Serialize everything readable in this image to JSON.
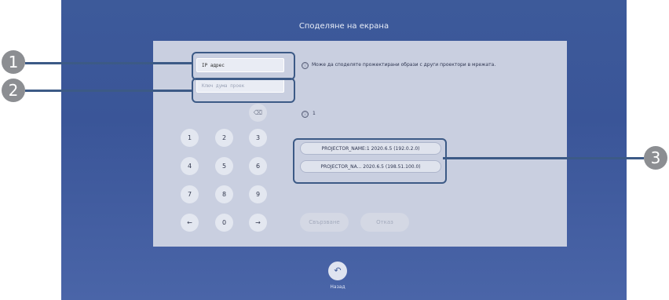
{
  "screen": {
    "title": "Споделяне на екрана"
  },
  "fields": {
    "ip": {
      "value": "IP адрес"
    },
    "keyword": {
      "placeholder": "Ключ дума проек"
    }
  },
  "info": {
    "icon": "ⓘ",
    "text": "Може да споделяте прожектирани образи с други проектори в мрежата."
  },
  "results": {
    "count": "1",
    "items": [
      "PROJECTOR_NAME:1  2020.6.5 (192.0.2.0)",
      "PROJECTOR_NA...  2020.6.5 (198.51.100.0)"
    ]
  },
  "keypad": {
    "keys": [
      "1",
      "2",
      "3",
      "4",
      "5",
      "6",
      "7",
      "8",
      "9",
      "←",
      "0",
      "→"
    ],
    "backspace": "⌫"
  },
  "actions": {
    "connect": "Свързване",
    "cancel": "Отказ"
  },
  "nav": {
    "back_label": "Назад",
    "back_icon": "↶"
  },
  "callouts": [
    "1",
    "2",
    "3"
  ]
}
